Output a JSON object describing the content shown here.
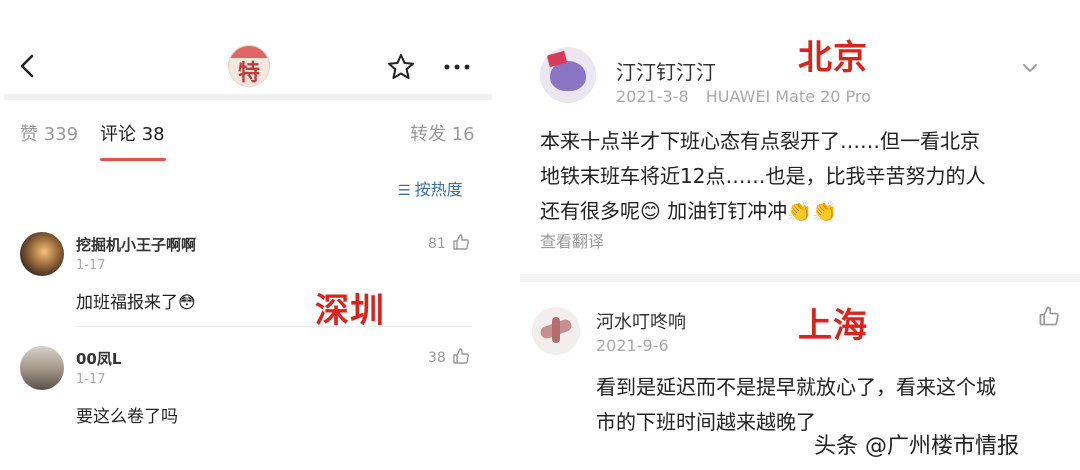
{
  "left": {
    "tabs": [
      {
        "label": "赞 339"
      },
      {
        "label": "评论 38"
      },
      {
        "label": "转发 16"
      }
    ],
    "sort_label": "按热度",
    "avatar_char": "特",
    "city_tag": "深圳",
    "comments": [
      {
        "name": "挖掘机小王子啊啊",
        "date": "1-17",
        "text": "加班福报来了",
        "emoji": "😳",
        "likes": "81"
      },
      {
        "name": "00凤L",
        "date": "1-17",
        "text": "要这么卷了吗",
        "likes": "38"
      }
    ]
  },
  "right": {
    "post": {
      "city_tag": "北京",
      "name": "汀汀钉汀汀",
      "date": "2021-3-8",
      "device": "HUAWEI Mate 20 Pro",
      "line1": "本来十点半才下班心态有点裂开了……但一看北京",
      "line2": "地铁末班车将近12点……也是，比我辛苦努力的人",
      "line3_text": "还有很多呢",
      "line3_emoji": "😊",
      "line3_rest": "加油钉钉冲冲",
      "line3_emoji2": "👏👏",
      "translate": "查看翻译"
    },
    "comment": {
      "city_tag": "上海",
      "name": "河水叮咚响",
      "date": "2021-9-6",
      "line1": "看到是延迟而不是提早就放心了，看来这个城",
      "line2": "市的下班时间越来越晚了"
    },
    "watermark": "头条 @广州楼市情报"
  },
  "colors": {
    "accent_red": "#d9231c",
    "tab_underline": "#e0534a",
    "sort_blue": "#3a6fb0"
  }
}
